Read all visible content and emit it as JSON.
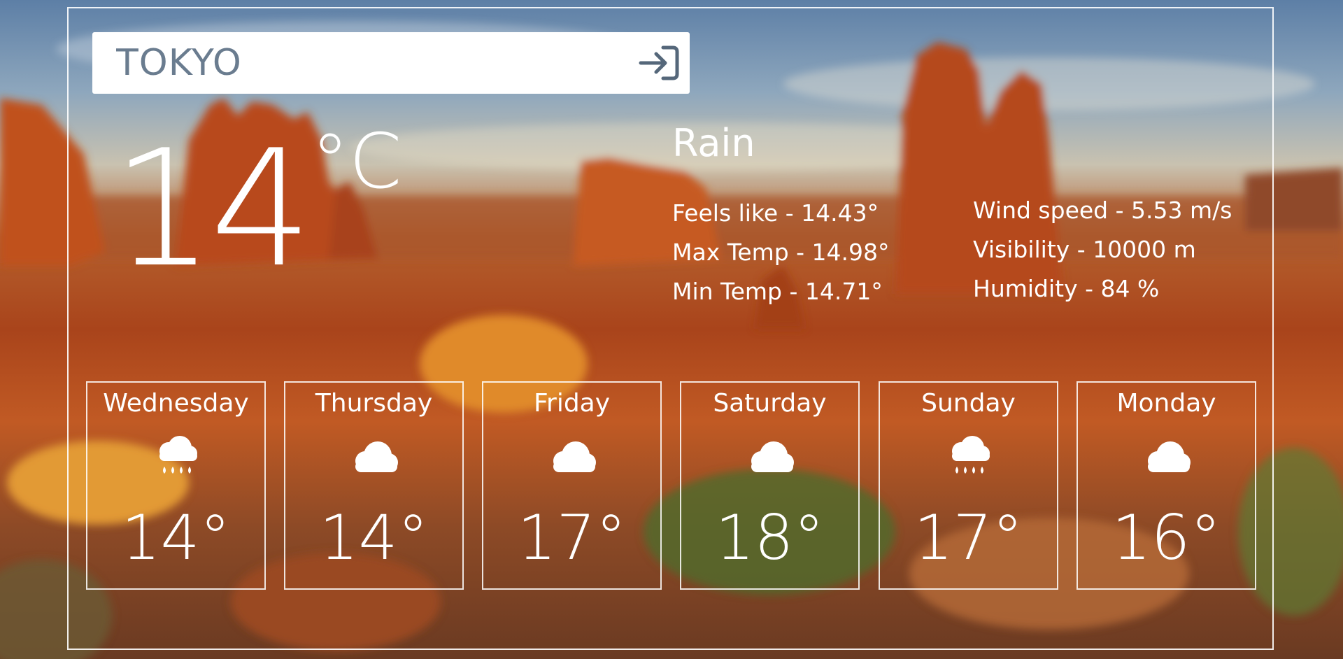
{
  "search": {
    "value": "TOKYO",
    "icon": "sign-in-icon"
  },
  "current": {
    "temp": "14",
    "unit": "°C",
    "condition": "Rain",
    "feels_like": "Feels like - 14.43°",
    "max_temp": "Max Temp - 14.98°",
    "min_temp": "Min Temp - 14.71°",
    "wind_speed": "Wind speed - 5.53 m/s",
    "visibility": "Visibility - 10000 m",
    "humidity": "Humidity - 84 %"
  },
  "forecast": [
    {
      "day": "Wednesday",
      "icon": "rain-cloud-icon",
      "temp": "14°"
    },
    {
      "day": "Thursday",
      "icon": "cloud-icon",
      "temp": "14°"
    },
    {
      "day": "Friday",
      "icon": "cloud-icon",
      "temp": "17°"
    },
    {
      "day": "Saturday",
      "icon": "cloud-icon",
      "temp": "18°"
    },
    {
      "day": "Sunday",
      "icon": "rain-cloud-icon",
      "temp": "17°"
    },
    {
      "day": "Monday",
      "icon": "cloud-icon",
      "temp": "16°"
    }
  ],
  "colors": {
    "text": "#ffffff",
    "search_text": "#6a7c8f",
    "search_bg": "#ffffff"
  }
}
